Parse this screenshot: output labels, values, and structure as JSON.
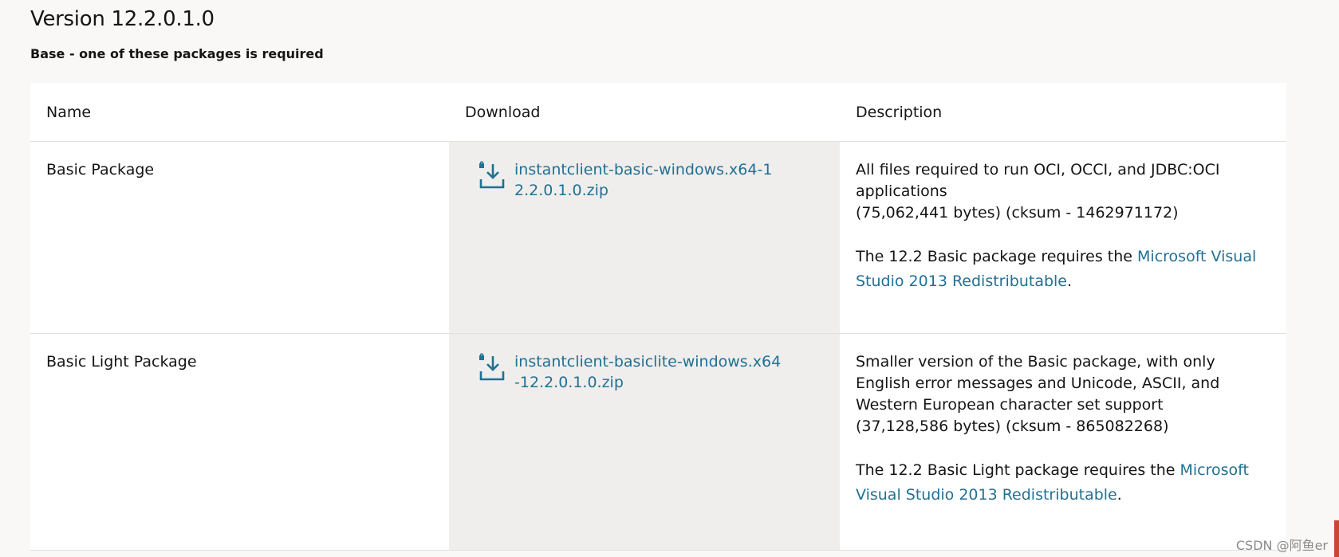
{
  "version_title": "Version 12.2.0.1.0",
  "subtitle": "Base - one of these packages is required",
  "table": {
    "headers": {
      "name": "Name",
      "download": "Download",
      "description": "Description"
    },
    "rows": [
      {
        "name": "Basic Package",
        "download_link": "instantclient-basic-windows.x64-12.2.0.1.0.zip",
        "description": "All files required to run OCI, OCCI, and JDBC:OCI applications",
        "size": "(75,062,441 bytes) (cksum - 1462971172)",
        "requires_prefix": "The 12.2 Basic package requires the ",
        "requires_link": "Microsoft Visual Studio 2013 Redistributable",
        "requires_suffix": "."
      },
      {
        "name": "Basic Light Package",
        "download_link": "instantclient-basiclite-windows.x64-12.2.0.1.0.zip",
        "description": "Smaller version of the Basic package, with only English error messages and Unicode, ASCII, and Western European character set support",
        "size": "(37,128,586 bytes) (cksum - 865082268)",
        "requires_prefix": "The 12.2 Basic Light package requires the ",
        "requires_link": "Microsoft Visual Studio 2013 Redistributable",
        "requires_suffix": "."
      }
    ]
  },
  "icons": {
    "download": "download-icon"
  },
  "colors": {
    "link": "#227094",
    "download_column_bg": "#efeeec",
    "page_bg": "#f9f8f6",
    "accent_edge": "#c74634"
  },
  "watermark": "CSDN @阿鱼er"
}
